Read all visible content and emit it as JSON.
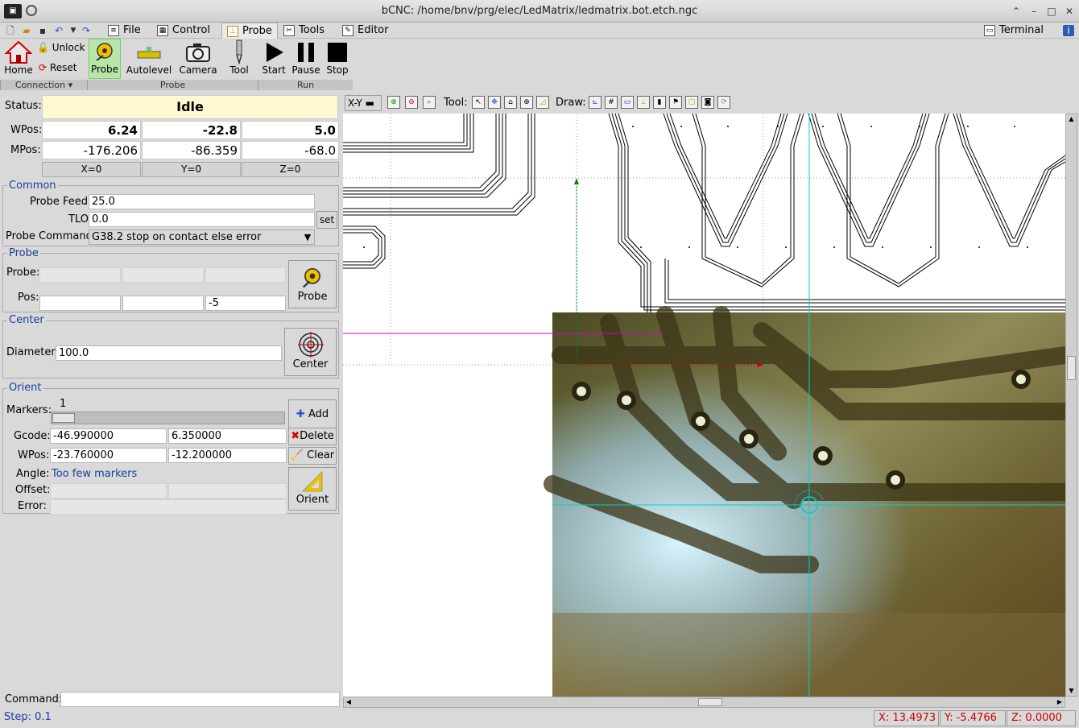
{
  "window": {
    "title": "bCNC: /home/bnv/prg/elec/LedMatrix/ledmatrix.bot.etch.ngc",
    "app_icon": "bcnc-logo-icon",
    "controls": [
      "minimize-icon",
      "restore-icon",
      "maximize-icon",
      "close-icon"
    ]
  },
  "menu": {
    "tabs": [
      {
        "label": "File",
        "icon": "file-icon"
      },
      {
        "label": "Control",
        "icon": "control-icon"
      },
      {
        "label": "Probe",
        "icon": "probe-icon",
        "active": true
      },
      {
        "label": "Tools",
        "icon": "tools-icon"
      },
      {
        "label": "Editor",
        "icon": "editor-icon"
      }
    ],
    "terminal": "Terminal",
    "quick_icons": [
      "new-file-icon",
      "open-file-icon",
      "save-icon",
      "undo-icon",
      "dropdown-icon",
      "redo-icon"
    ]
  },
  "ribbon": {
    "home": "Home",
    "unlock": "Unlock",
    "reset": "Reset",
    "probe": "Probe",
    "autolevel": "Autolevel",
    "camera": "Camera",
    "tool": "Tool",
    "start": "Start",
    "pause": "Pause",
    "stop": "Stop",
    "groups": {
      "connection": "Connection",
      "probe": "Probe",
      "run": "Run"
    }
  },
  "state": {
    "status_label": "Status:",
    "status": "Idle",
    "wpos_label": "WPos:",
    "mpos_label": "MPos:",
    "wpos": [
      "6.24",
      "-22.8",
      "5.0"
    ],
    "mpos": [
      "-176.206",
      "-86.359",
      "-68.0"
    ],
    "zero": [
      "X=0",
      "Y=0",
      "Z=0"
    ]
  },
  "common": {
    "legend": "Common",
    "probe_feed_label": "Probe Feed:",
    "probe_feed": "25.0",
    "tlo_label": "TLO",
    "tlo": "0.0",
    "set": "set",
    "probe_cmd_label": "Probe Command",
    "probe_cmd": "G38.2 stop on contact else error"
  },
  "probe": {
    "legend": "Probe",
    "probe_label": "Probe:",
    "pos_label": "Pos:",
    "pos": [
      "",
      "",
      "-5"
    ],
    "button": "Probe"
  },
  "center": {
    "legend": "Center",
    "diameter_label": "Diameter:",
    "diameter": "100.0",
    "button": "Center"
  },
  "orient": {
    "legend": "Orient",
    "markers_label": "Markers:",
    "marker_value": "1",
    "slider_fraction": 0.0,
    "add": "Add",
    "gcode_label": "Gcode:",
    "gcode": [
      "-46.990000",
      "6.350000"
    ],
    "delete": "Delete",
    "wpos_label": "WPos:",
    "wpos": [
      "-23.760000",
      "-12.200000"
    ],
    "clear": "Clear",
    "angle_label": "Angle:",
    "angle": "Too few markers",
    "offset_label": "Offset:",
    "error_label": "Error:",
    "button": "Orient"
  },
  "command": {
    "label": "Command:",
    "value": ""
  },
  "canvas_toolbar": {
    "view": "X-Y",
    "tool_label": "Tool:",
    "draw_label": "Draw:"
  },
  "statusbar": {
    "step": "Step: 0.1",
    "x": "X: 13.4973",
    "y": "Y: -5.4766",
    "z": "Z: 0.0000"
  },
  "colors": {
    "status_bg": "#fff8d0",
    "link_blue": "#1a3f9b",
    "coord_red": "#cc0000",
    "crosshair": "#00c8c8",
    "magenta": "#d000d0"
  }
}
